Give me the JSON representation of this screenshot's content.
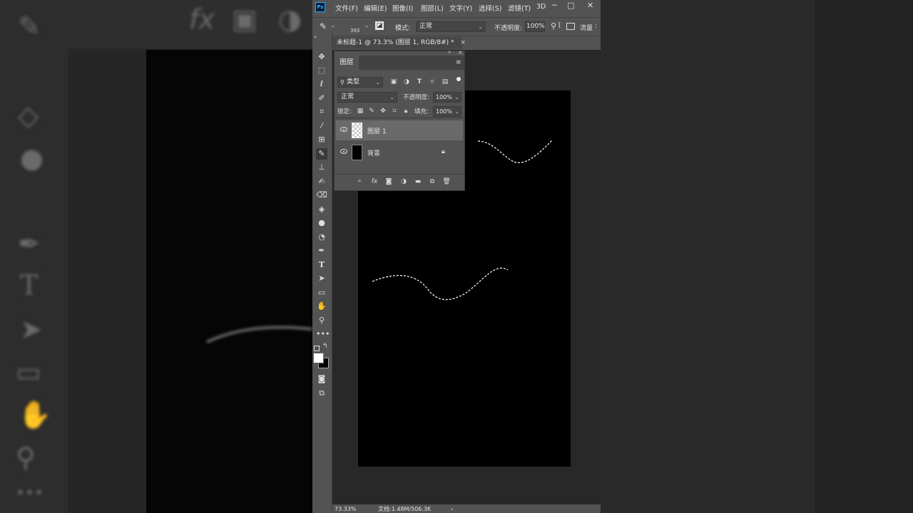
{
  "menu": {
    "app_logo": "Ps",
    "items": [
      "文件(F)",
      "编辑(E)",
      "图像(I)",
      "图层(L)",
      "文字(Y)",
      "选择(S)",
      "滤镜(T)",
      "3D"
    ],
    "window_controls": [
      "─",
      "□",
      "✕"
    ]
  },
  "options": {
    "brush_size": "393",
    "mode_label": "模式:",
    "mode_value": "正常",
    "opacity_label": "不透明度:",
    "opacity_value": "100%",
    "flow_label": "流量"
  },
  "document": {
    "tab_title": "未标题-1 @ 73.3% (图层 1, RGB/8#) *",
    "tab_close": "×"
  },
  "layers_panel": {
    "title": "图层",
    "filter_label": "类型",
    "blend_mode": "正常",
    "opacity_label": "不透明度:",
    "opacity_value": "100%",
    "lock_label": "锁定:",
    "fill_label": "填充:",
    "fill_value": "100%",
    "layers": [
      {
        "name": "图层 1",
        "selected": true
      },
      {
        "name": "背景",
        "selected": false,
        "locked": true
      }
    ],
    "footer_icons": [
      "link-icon",
      "fx-icon",
      "mask-icon",
      "adjustment-icon",
      "folder-icon",
      "new-layer-icon",
      "trash-icon"
    ]
  },
  "status": {
    "zoom": "73.33%",
    "doc_info": "文档:1.48M/506.3K"
  },
  "colors": {
    "ui_gray": "#535353",
    "work_area": "#282828",
    "canvas": "#000000",
    "ps_blue": "#31a8ff"
  }
}
